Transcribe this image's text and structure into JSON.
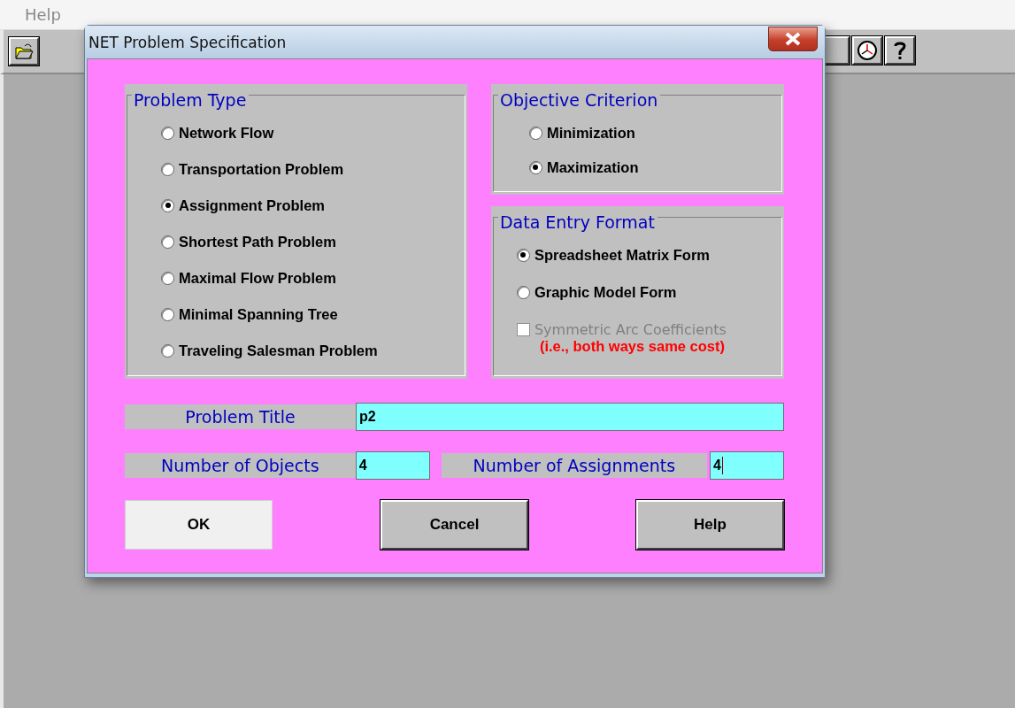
{
  "menu_bar": {
    "items": [
      {
        "label": "Help"
      }
    ]
  },
  "dialog": {
    "title": "NET Problem Specification",
    "problem_type": {
      "title": "Problem Type",
      "options": [
        {
          "label": "Network Flow",
          "selected": false
        },
        {
          "label": "Transportation Problem",
          "selected": false
        },
        {
          "label": "Assignment Problem",
          "selected": true
        },
        {
          "label": "Shortest Path Problem",
          "selected": false
        },
        {
          "label": "Maximal Flow Problem",
          "selected": false
        },
        {
          "label": "Minimal Spanning Tree",
          "selected": false
        },
        {
          "label": "Traveling Salesman Problem",
          "selected": false
        }
      ]
    },
    "objective_criterion": {
      "title": "Objective Criterion",
      "options": [
        {
          "label": "Minimization",
          "selected": false
        },
        {
          "label": "Maximization",
          "selected": true
        }
      ]
    },
    "data_entry_format": {
      "title": "Data Entry Format",
      "options": [
        {
          "label": "Spreadsheet Matrix Form",
          "selected": true
        },
        {
          "label": "Graphic Model Form",
          "selected": false
        }
      ],
      "checkbox": {
        "label": "Symmetric Arc Coefficients",
        "note": "(i.e., both ways same cost)",
        "checked": false,
        "disabled": true
      }
    },
    "problem_title": {
      "label": "Problem Title",
      "value": "p2",
      "focused": false
    },
    "number_of_objects": {
      "label": "Number of Objects",
      "value": "4",
      "focused": false
    },
    "number_of_assignments": {
      "label": "Number of Assignments",
      "value": "4",
      "focused": true
    },
    "buttons": [
      {
        "label": "OK",
        "focused": true
      },
      {
        "label": "Cancel",
        "focused": false
      },
      {
        "label": "Help",
        "focused": false
      }
    ]
  }
}
